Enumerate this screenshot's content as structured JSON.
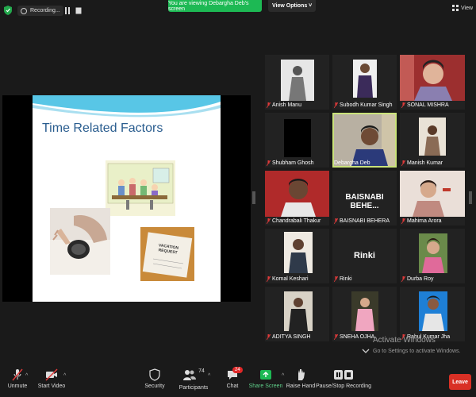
{
  "topbar": {
    "recording_label": "Recording...",
    "share_banner": "You are viewing Debargha Deb's screen",
    "view_options": "View Options ˅",
    "view_label": "View"
  },
  "slide": {
    "title": "Time Related Factors",
    "request_text": "VACATION REQUEST"
  },
  "participants": [
    {
      "name": "Anish Manu"
    },
    {
      "name": "Subodh Kumar Singh"
    },
    {
      "name": "SONAL MISHRA"
    },
    {
      "name": "Shubham Ghosh"
    },
    {
      "name": "Debargha Deb"
    },
    {
      "name": "Manish Kumar"
    },
    {
      "name": "Chandrabali Thakur"
    },
    {
      "name": "BAISNABI BEHERA",
      "display": "BAISNABI  BEHE..."
    },
    {
      "name": "Mahima Arora"
    },
    {
      "name": "Komal Keshari"
    },
    {
      "name": "Rinki",
      "display": "Rinki"
    },
    {
      "name": "Durba Roy"
    },
    {
      "name": "ADITYA SINGH"
    },
    {
      "name": "SNEHA OJHA"
    },
    {
      "name": "Rahul Kumar Jha"
    }
  ],
  "watermark": {
    "line1": "Activate Windows",
    "line2": "Go to Settings to activate Windows."
  },
  "toolbar": {
    "unmute": "Unmute",
    "start_video": "Start Video",
    "security": "Security",
    "participants": "Participants",
    "participants_count": "74",
    "chat": "Chat",
    "chat_badge": "24",
    "share_screen": "Share Screen",
    "raise_hand": "Raise Hand",
    "pause_recording": "Pause/Stop Recording",
    "leave": "Leave"
  },
  "colors": {
    "share_green": "#1db954",
    "leave_red": "#d93025",
    "active_speaker": "#c9e27a",
    "slide_title": "#2a5d8f"
  }
}
